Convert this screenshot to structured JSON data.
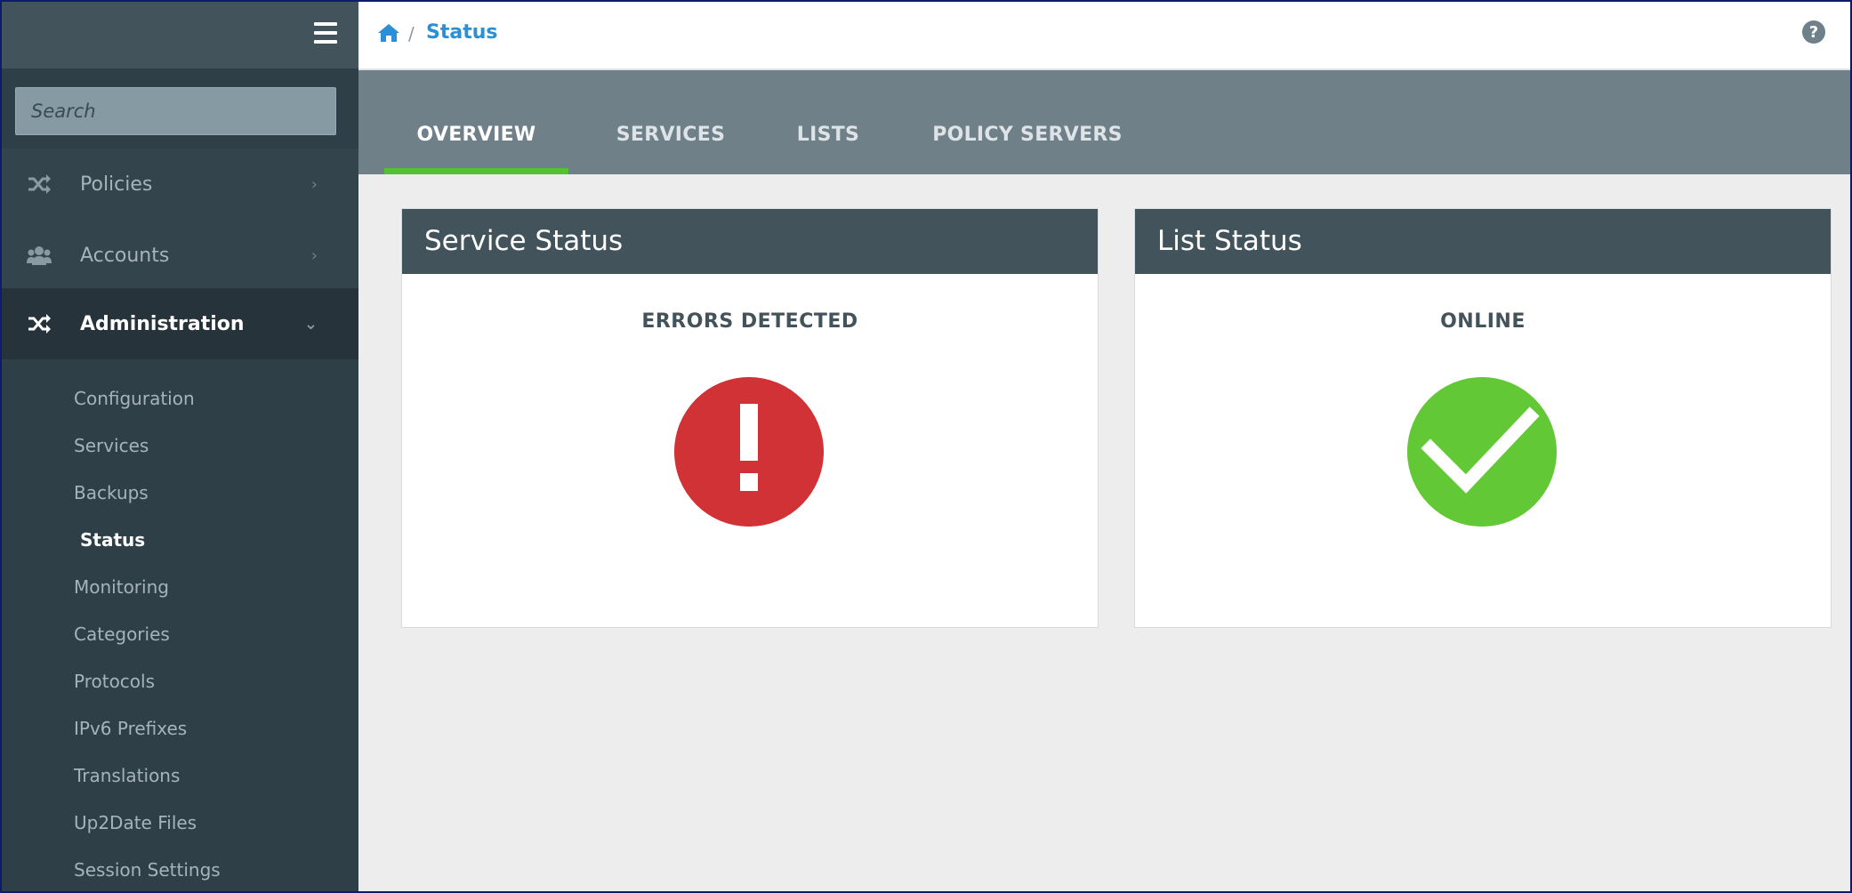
{
  "sidebar": {
    "search_placeholder": "Search",
    "nav": {
      "policies": "Policies",
      "accounts": "Accounts",
      "administration": "Administration"
    },
    "sub_items": [
      "Configuration",
      "Services",
      "Backups",
      "Status",
      "Monitoring",
      "Categories",
      "Protocols",
      "IPv6 Prefixes",
      "Translations",
      "Up2Date Files",
      "Session Settings"
    ],
    "active_sub_item": "Status"
  },
  "topbar": {
    "breadcrumb_separator": "/",
    "breadcrumb_current": "Status",
    "help_glyph": "?"
  },
  "tabs": [
    {
      "label": "OVERVIEW",
      "active": true
    },
    {
      "label": "SERVICES",
      "active": false
    },
    {
      "label": "LISTS",
      "active": false
    },
    {
      "label": "POLICY SERVERS",
      "active": false
    }
  ],
  "cards": {
    "service": {
      "title": "Service Status",
      "status": "ERRORS DETECTED",
      "icon": "error-exclamation-icon",
      "color": "#d03235"
    },
    "list": {
      "title": "List Status",
      "status": "ONLINE",
      "icon": "check-icon",
      "color": "#63c836"
    }
  },
  "colors": {
    "accent_blue": "#2a8fd6",
    "tab_underline": "#52c234",
    "sidebar_bg": "#2f3f48"
  }
}
